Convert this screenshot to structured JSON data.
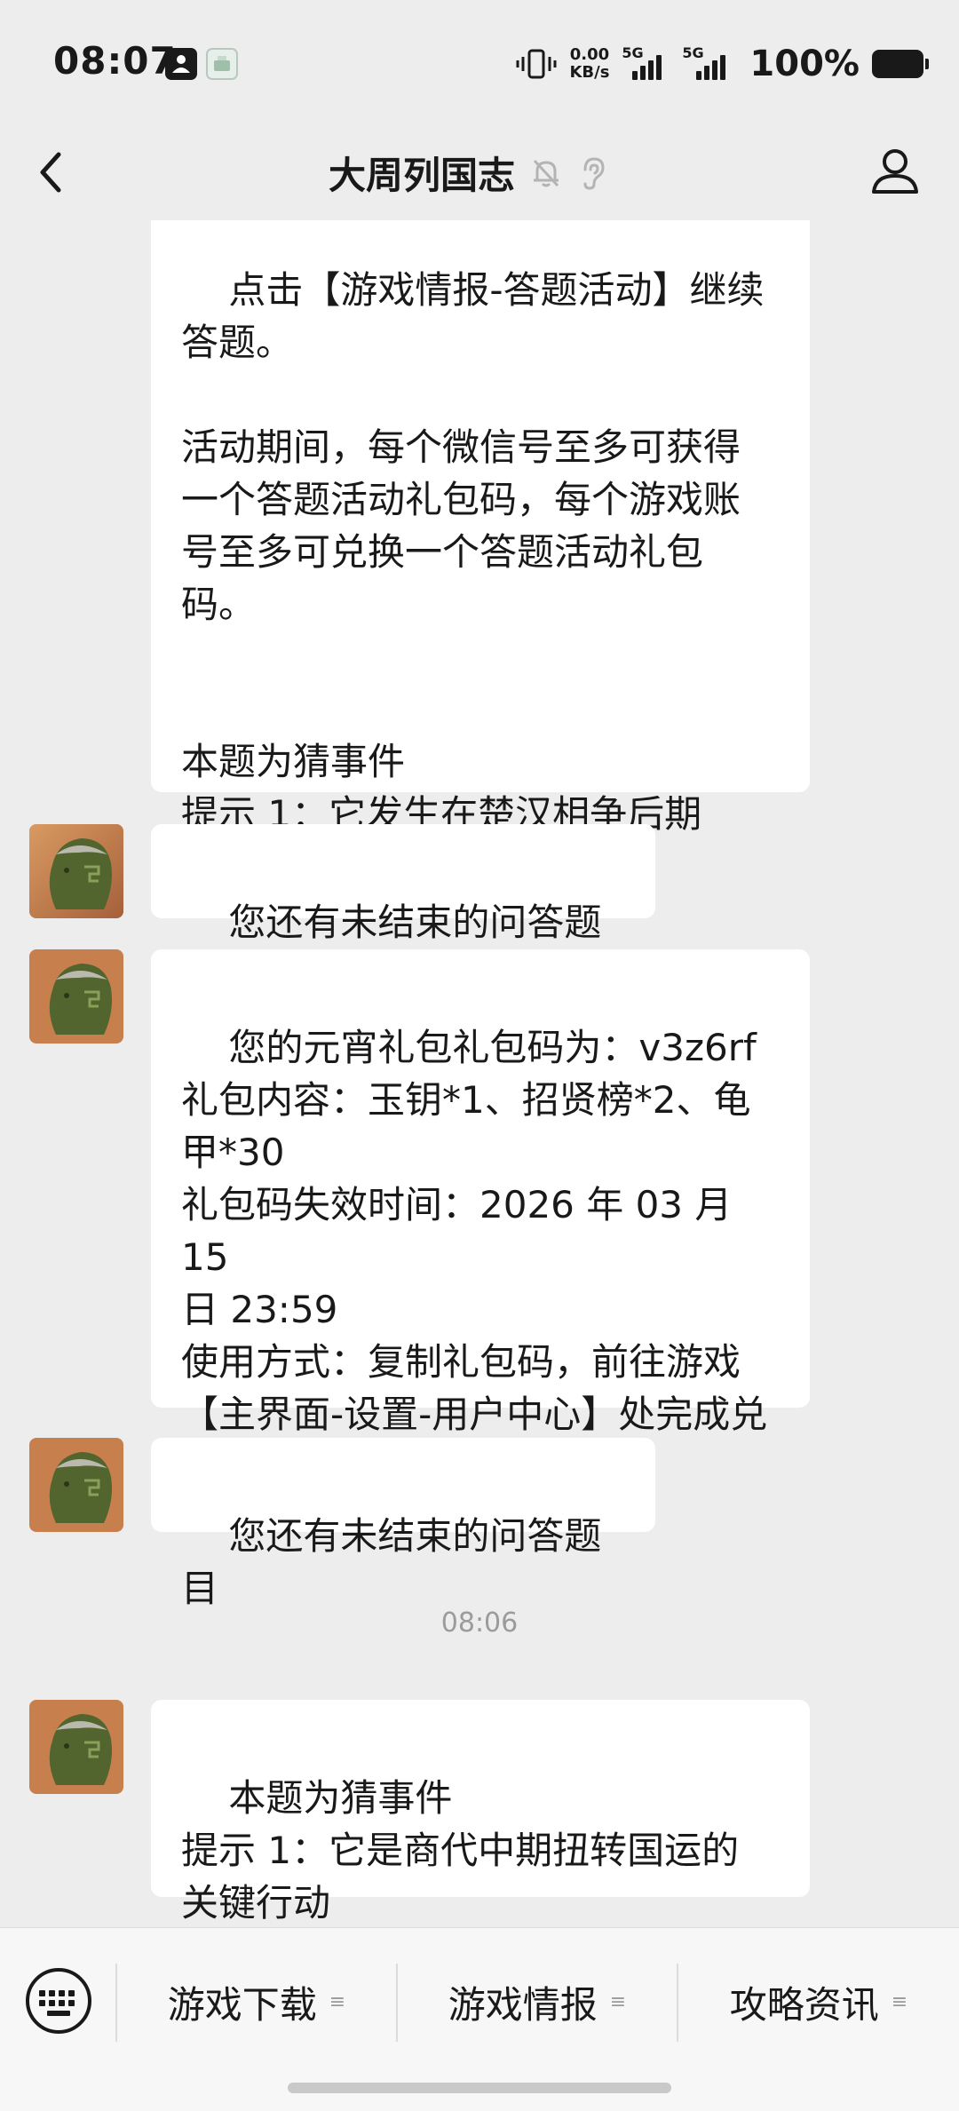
{
  "status_bar": {
    "time": "08:07",
    "net_speed_value": "0.00",
    "net_speed_unit": "KB/s",
    "signal1_label": "5G",
    "signal2_label": "5G",
    "battery_percent": "100%"
  },
  "header": {
    "title": "大周列国志"
  },
  "messages": [
    {
      "text": "点击【游戏情报-答题活动】继续\n答题。\n\n活动期间，每个微信号至多可获得\n一个答题活动礼包码，每个游戏账\n号至多可兑换一个答题活动礼包\n码。\n\n\n本题为猜事件\n提示 1：它发生在楚汉相争后期"
    },
    {
      "text": "您还有未结束的问答题目"
    },
    {
      "text": "您的元宵礼包礼包码为：v3z6rf\n礼包内容：玉钥*1、招贤榜*2、龟\n甲*30\n礼包码失效时间：2026 年 03 月 15\n日 23:59\n使用方式：复制礼包码，前往游戏\n【主界面-设置-用户中心】处完成兑\n换"
    },
    {
      "text": "您还有未结束的问答题目"
    },
    {
      "text": "本题为猜事件\n提示 1：它是商代中期扭转国运的\n关键行动"
    }
  ],
  "timestamp": "08:06",
  "menu": {
    "items": [
      {
        "label": "游戏下载"
      },
      {
        "label": "游戏情报"
      },
      {
        "label": "攻略资讯"
      }
    ]
  },
  "colors": {
    "background": "#ededed",
    "bubble": "#ffffff",
    "text": "#191919",
    "muted": "#9b9b9b"
  }
}
